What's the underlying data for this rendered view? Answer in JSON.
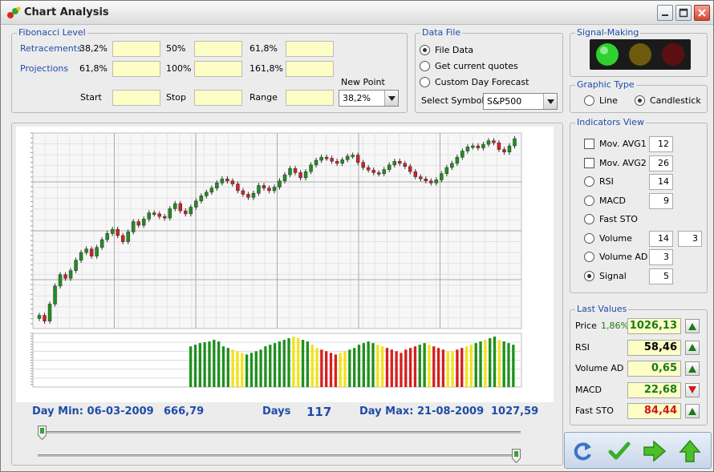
{
  "window": {
    "title": "Chart Analysis"
  },
  "fibonacci": {
    "title": "Fibonacci Level",
    "retracements_label": "Retracements",
    "projections_label": "Projections",
    "ret_levels": [
      "38,2%",
      "50%",
      "61,8%"
    ],
    "proj_levels": [
      "61,8%",
      "100%",
      "161,8%"
    ],
    "start_label": "Start",
    "stop_label": "Stop",
    "range_label": "Range",
    "new_point_label": "New Point",
    "new_point_value": "38,2%"
  },
  "data_file": {
    "title": "Data File",
    "options": [
      "File Data",
      "Get current quotes",
      "Custom Day Forecast"
    ],
    "selected": 0,
    "symbol_label": "Select Symbol",
    "symbol_value": "S&P500"
  },
  "signal_making": {
    "title": "Signal-Making",
    "lights": [
      "green-on",
      "yellow-off",
      "red-off"
    ]
  },
  "graphic_type": {
    "title": "Graphic Type",
    "options": [
      "Line",
      "Candlestick"
    ],
    "selected": 1
  },
  "indicators": {
    "title": "Indicators View",
    "items": [
      {
        "label": "Mov. AVG1",
        "kind": "check",
        "checked": false,
        "v1": "12"
      },
      {
        "label": "Mov. AVG2",
        "kind": "check",
        "checked": false,
        "v1": "26"
      },
      {
        "label": "RSI",
        "kind": "radio",
        "checked": false,
        "v1": "14"
      },
      {
        "label": "MACD",
        "kind": "radio",
        "checked": false,
        "v1": "9"
      },
      {
        "label": "Fast STO",
        "kind": "radio",
        "checked": false
      },
      {
        "label": "Volume",
        "kind": "radio",
        "checked": false,
        "v1": "14",
        "v2": "3"
      },
      {
        "label": "Volume AD",
        "kind": "radio",
        "checked": false,
        "v1": "3"
      },
      {
        "label": "Signal",
        "kind": "radio",
        "checked": true,
        "v1": "5"
      }
    ]
  },
  "last_values": {
    "title": "Last Values",
    "price_label": "Price",
    "price_change": "1,86%",
    "rows": [
      {
        "label": "Price",
        "value": "1026,13",
        "color": "#1a7a1a",
        "dir": "up"
      },
      {
        "label": "RSI",
        "value": "58,46",
        "color": "#000000",
        "dir": "up"
      },
      {
        "label": "Volume AD",
        "value": "0,65",
        "color": "#1a7a1a",
        "dir": "up"
      },
      {
        "label": "MACD",
        "value": "22,68",
        "color": "#1a7a1a",
        "dir": "down"
      },
      {
        "label": "Fast STO",
        "value": "84,44",
        "color": "#d01818",
        "dir": "up"
      }
    ]
  },
  "stats": {
    "day_min": "Day Min: 06-03-2009",
    "min_value": "666,79",
    "days_label": "Days",
    "days_value": "117",
    "day_max": "Day Max: 21-08-2009",
    "max_value": "1027,59"
  },
  "sliders": {
    "start_fraction": 0.0,
    "end_fraction": 1.0
  },
  "chart_data": {
    "type": "candlestick",
    "xlabel": "",
    "ylabel": "",
    "ylim": [
      666.79,
      1027.59
    ],
    "closes": [
      683,
      672,
      705,
      740,
      762,
      755,
      770,
      790,
      805,
      812,
      798,
      815,
      830,
      842,
      850,
      838,
      826,
      845,
      865,
      858,
      870,
      882,
      880,
      875,
      872,
      890,
      900,
      886,
      880,
      893,
      905,
      915,
      922,
      930,
      940,
      948,
      944,
      938,
      925,
      918,
      912,
      920,
      935,
      930,
      925,
      932,
      944,
      956,
      968,
      960,
      950,
      962,
      975,
      984,
      990,
      988,
      982,
      978,
      985,
      992,
      994,
      980,
      970,
      965,
      960,
      958,
      966,
      975,
      982,
      978,
      972,
      962,
      952,
      948,
      944,
      940,
      946,
      958,
      970,
      978,
      990,
      1002,
      1010,
      1012,
      1008,
      1015,
      1022,
      1018,
      1005,
      1000,
      1012,
      1026
    ],
    "volume": [
      50,
      52,
      54,
      55,
      56,
      58,
      56,
      50,
      48,
      46,
      44,
      42,
      40,
      42,
      44,
      46,
      50,
      52,
      54,
      56,
      58,
      60,
      62,
      60,
      58,
      56,
      52,
      48,
      46,
      44,
      42,
      40,
      42,
      44,
      46,
      48,
      52,
      54,
      56,
      54,
      52,
      50,
      48,
      46,
      44,
      42,
      46,
      48,
      50,
      52,
      54,
      52,
      50,
      48,
      46,
      44,
      44,
      46,
      48,
      50,
      52,
      54,
      56,
      58,
      60,
      62,
      58,
      56,
      54,
      52
    ],
    "volume_colors": [
      "g",
      "g",
      "g",
      "g",
      "g",
      "g",
      "g",
      "g",
      "g",
      "y",
      "y",
      "y",
      "g",
      "g",
      "g",
      "g",
      "g",
      "g",
      "g",
      "g",
      "g",
      "g",
      "y",
      "y",
      "g",
      "g",
      "y",
      "y",
      "r",
      "r",
      "r",
      "r",
      "y",
      "y",
      "g",
      "g",
      "g",
      "g",
      "g",
      "g",
      "y",
      "y",
      "r",
      "r",
      "r",
      "r",
      "r",
      "r",
      "r",
      "g",
      "g",
      "y",
      "r",
      "r",
      "r",
      "y",
      "y",
      "r",
      "r",
      "y",
      "y",
      "g",
      "g",
      "y",
      "g",
      "g",
      "y",
      "g",
      "g",
      "g"
    ]
  },
  "toolbar": {
    "buttons": [
      "refresh",
      "ok",
      "next",
      "up"
    ]
  }
}
